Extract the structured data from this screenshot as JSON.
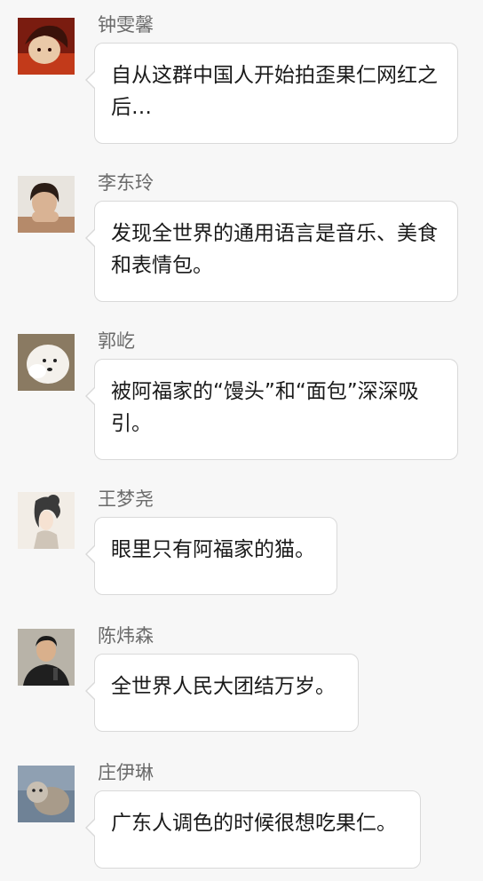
{
  "messages": [
    {
      "name": "钟雯馨",
      "text": "自从这群中国人开始拍歪果仁网红之后…"
    },
    {
      "name": "李东玲",
      "text": "发现全世界的通用语言是音乐、美食和表情包。"
    },
    {
      "name": "郭屹",
      "text": "被阿福家的“馒头”和“面包”深深吸引。"
    },
    {
      "name": "王梦尧",
      "text": "眼里只有阿福家的猫。"
    },
    {
      "name": "陈炜森",
      "text": "全世界人民大团结万岁。"
    },
    {
      "name": "庄伊琳",
      "text": "广东人调色的时候很想吃果仁。"
    }
  ],
  "colors": {
    "background": "#f7f7f7",
    "bubble": "#ffffff",
    "bubble_border": "#d9d9d9",
    "name_text": "#6a6a6a",
    "message_text": "#1a1a1a"
  }
}
